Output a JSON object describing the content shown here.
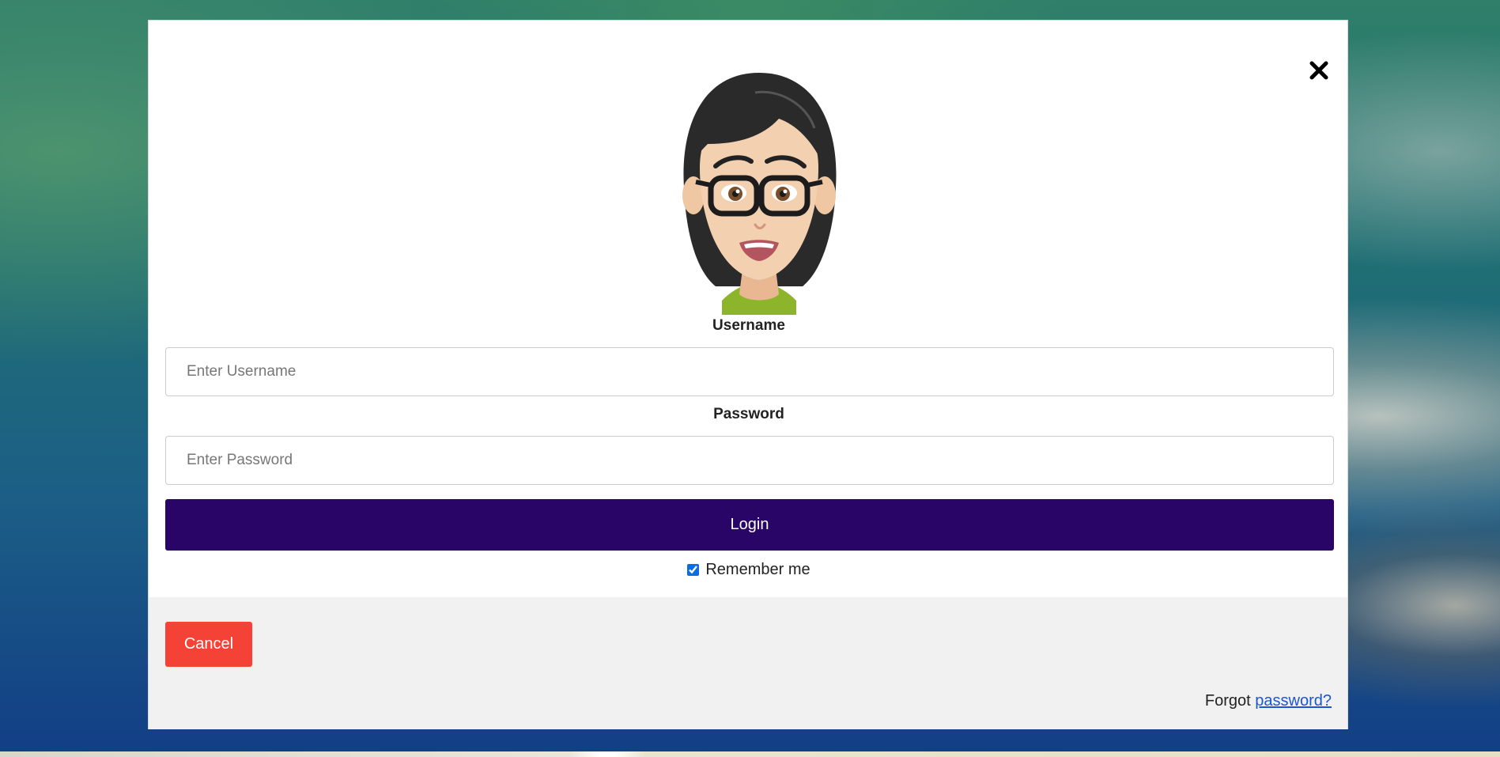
{
  "modal": {
    "close_icon": "close-icon",
    "avatar_icon": "user-avatar-illustration"
  },
  "form": {
    "username_label": "Username",
    "username_placeholder": "Enter Username",
    "username_value": "",
    "password_label": "Password",
    "password_placeholder": "Enter Password",
    "password_value": "",
    "login_label": "Login",
    "remember_label": "Remember me",
    "remember_checked": true
  },
  "footer": {
    "cancel_label": "Cancel",
    "forgot_prefix": "Forgot",
    "forgot_link": "password?"
  },
  "colors": {
    "login_button": "#280566",
    "cancel_button": "#f44336",
    "link": "#1a55d6",
    "footer_background": "#f1f1f1"
  }
}
